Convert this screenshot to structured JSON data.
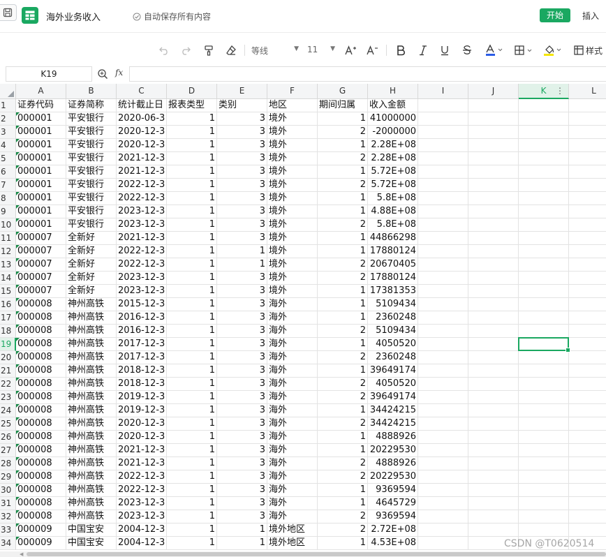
{
  "colors": {
    "accent": "#1aa861",
    "selected_header_bg": "#e1f2e9"
  },
  "header": {
    "doc_title": "海外业务收入",
    "autosave_text": "自动保存所有内容",
    "start_label": "开始",
    "insert_label": "插入"
  },
  "toolbar": {
    "font_name": "等线",
    "font_size": "11",
    "style_label": "样式",
    "icons": [
      "undo-icon",
      "redo-icon",
      "format-painter-icon",
      "eraser-icon",
      "font-grow-icon",
      "font-shrink-icon",
      "bold-icon",
      "italic-icon",
      "underline-icon",
      "strikethrough-icon",
      "font-color-icon",
      "border-icon",
      "fill-color-icon",
      "cell-style-icon"
    ]
  },
  "formula_bar": {
    "cell_ref": "K19",
    "formula": "",
    "fx_label": "fx"
  },
  "sheet": {
    "columns": [
      "A",
      "B",
      "C",
      "D",
      "E",
      "F",
      "G",
      "H",
      "I",
      "J",
      "K",
      "L"
    ],
    "active_column": "K",
    "active_row": "19",
    "rows": [
      {
        "n": "1",
        "a": "证券代码",
        "b": "证券简称",
        "c": "统计截止日",
        "d": "报表类型",
        "e": "类别",
        "f": "地区",
        "g": "期间归属",
        "h": "收入金额"
      },
      {
        "n": "2",
        "a": "000001",
        "b": "平安银行",
        "c": "2020-06-3",
        "d": "1",
        "e": "3",
        "f": "境外",
        "g": "1",
        "h": "41000000"
      },
      {
        "n": "3",
        "a": "000001",
        "b": "平安银行",
        "c": "2020-12-3",
        "d": "1",
        "e": "3",
        "f": "境外",
        "g": "2",
        "h": "-2000000"
      },
      {
        "n": "4",
        "a": "000001",
        "b": "平安银行",
        "c": "2020-12-3",
        "d": "1",
        "e": "3",
        "f": "境外",
        "g": "1",
        "h": "2.28E+08"
      },
      {
        "n": "5",
        "a": "000001",
        "b": "平安银行",
        "c": "2021-12-3",
        "d": "1",
        "e": "3",
        "f": "境外",
        "g": "2",
        "h": "2.28E+08"
      },
      {
        "n": "6",
        "a": "000001",
        "b": "平安银行",
        "c": "2021-12-3",
        "d": "1",
        "e": "3",
        "f": "境外",
        "g": "1",
        "h": "5.72E+08"
      },
      {
        "n": "7",
        "a": "000001",
        "b": "平安银行",
        "c": "2022-12-3",
        "d": "1",
        "e": "3",
        "f": "境外",
        "g": "2",
        "h": "5.72E+08"
      },
      {
        "n": "8",
        "a": "000001",
        "b": "平安银行",
        "c": "2022-12-3",
        "d": "1",
        "e": "3",
        "f": "境外",
        "g": "1",
        "h": "5.8E+08"
      },
      {
        "n": "9",
        "a": "000001",
        "b": "平安银行",
        "c": "2023-12-3",
        "d": "1",
        "e": "3",
        "f": "境外",
        "g": "1",
        "h": "4.88E+08"
      },
      {
        "n": "10",
        "a": "000001",
        "b": "平安银行",
        "c": "2023-12-3",
        "d": "1",
        "e": "3",
        "f": "境外",
        "g": "2",
        "h": "5.8E+08"
      },
      {
        "n": "11",
        "a": "000007",
        "b": "全新好",
        "c": "2021-12-3",
        "d": "1",
        "e": "3",
        "f": "境外",
        "g": "1",
        "h": "44866298"
      },
      {
        "n": "12",
        "a": "000007",
        "b": "全新好",
        "c": "2022-12-3",
        "d": "1",
        "e": "1",
        "f": "境外",
        "g": "1",
        "h": "17880124"
      },
      {
        "n": "13",
        "a": "000007",
        "b": "全新好",
        "c": "2022-12-3",
        "d": "1",
        "e": "1",
        "f": "境外",
        "g": "2",
        "h": "20670405"
      },
      {
        "n": "14",
        "a": "000007",
        "b": "全新好",
        "c": "2023-12-3",
        "d": "1",
        "e": "3",
        "f": "境外",
        "g": "2",
        "h": "17880124"
      },
      {
        "n": "15",
        "a": "000007",
        "b": "全新好",
        "c": "2023-12-3",
        "d": "1",
        "e": "3",
        "f": "境外",
        "g": "1",
        "h": "17381353"
      },
      {
        "n": "16",
        "a": "000008",
        "b": "神州高铁",
        "c": "2015-12-3",
        "d": "1",
        "e": "3",
        "f": "海外",
        "g": "1",
        "h": "5109434"
      },
      {
        "n": "17",
        "a": "000008",
        "b": "神州高铁",
        "c": "2016-12-3",
        "d": "1",
        "e": "3",
        "f": "海外",
        "g": "1",
        "h": "2360248"
      },
      {
        "n": "18",
        "a": "000008",
        "b": "神州高铁",
        "c": "2016-12-3",
        "d": "1",
        "e": "3",
        "f": "海外",
        "g": "2",
        "h": "5109434"
      },
      {
        "n": "19",
        "a": "000008",
        "b": "神州高铁",
        "c": "2017-12-3",
        "d": "1",
        "e": "3",
        "f": "海外",
        "g": "1",
        "h": "4050520"
      },
      {
        "n": "20",
        "a": "000008",
        "b": "神州高铁",
        "c": "2017-12-3",
        "d": "1",
        "e": "3",
        "f": "海外",
        "g": "2",
        "h": "2360248"
      },
      {
        "n": "21",
        "a": "000008",
        "b": "神州高铁",
        "c": "2018-12-3",
        "d": "1",
        "e": "3",
        "f": "海外",
        "g": "1",
        "h": "39649174"
      },
      {
        "n": "22",
        "a": "000008",
        "b": "神州高铁",
        "c": "2018-12-3",
        "d": "1",
        "e": "3",
        "f": "海外",
        "g": "2",
        "h": "4050520"
      },
      {
        "n": "23",
        "a": "000008",
        "b": "神州高铁",
        "c": "2019-12-3",
        "d": "1",
        "e": "3",
        "f": "海外",
        "g": "2",
        "h": "39649174"
      },
      {
        "n": "24",
        "a": "000008",
        "b": "神州高铁",
        "c": "2019-12-3",
        "d": "1",
        "e": "3",
        "f": "海外",
        "g": "1",
        "h": "34424215"
      },
      {
        "n": "25",
        "a": "000008",
        "b": "神州高铁",
        "c": "2020-12-3",
        "d": "1",
        "e": "3",
        "f": "海外",
        "g": "2",
        "h": "34424215"
      },
      {
        "n": "26",
        "a": "000008",
        "b": "神州高铁",
        "c": "2020-12-3",
        "d": "1",
        "e": "3",
        "f": "海外",
        "g": "1",
        "h": "4888926"
      },
      {
        "n": "27",
        "a": "000008",
        "b": "神州高铁",
        "c": "2021-12-3",
        "d": "1",
        "e": "3",
        "f": "海外",
        "g": "1",
        "h": "20229530"
      },
      {
        "n": "28",
        "a": "000008",
        "b": "神州高铁",
        "c": "2021-12-3",
        "d": "1",
        "e": "3",
        "f": "海外",
        "g": "2",
        "h": "4888926"
      },
      {
        "n": "29",
        "a": "000008",
        "b": "神州高铁",
        "c": "2022-12-3",
        "d": "1",
        "e": "3",
        "f": "海外",
        "g": "2",
        "h": "20229530"
      },
      {
        "n": "30",
        "a": "000008",
        "b": "神州高铁",
        "c": "2022-12-3",
        "d": "1",
        "e": "3",
        "f": "海外",
        "g": "1",
        "h": "9369594"
      },
      {
        "n": "31",
        "a": "000008",
        "b": "神州高铁",
        "c": "2023-12-3",
        "d": "1",
        "e": "3",
        "f": "海外",
        "g": "1",
        "h": "4645729"
      },
      {
        "n": "32",
        "a": "000008",
        "b": "神州高铁",
        "c": "2023-12-3",
        "d": "1",
        "e": "3",
        "f": "海外",
        "g": "2",
        "h": "9369594"
      },
      {
        "n": "33",
        "a": "000009",
        "b": "中国宝安",
        "c": "2004-12-3",
        "d": "1",
        "e": "1",
        "f": "境外地区",
        "g": "2",
        "h": "2.72E+08"
      },
      {
        "n": "34",
        "a": "000009",
        "b": "中国宝安",
        "c": "2004-12-3",
        "d": "1",
        "e": "1",
        "f": "境外地区",
        "g": "1",
        "h": "4.53E+08"
      }
    ]
  },
  "watermark": "CSDN @T0620514"
}
